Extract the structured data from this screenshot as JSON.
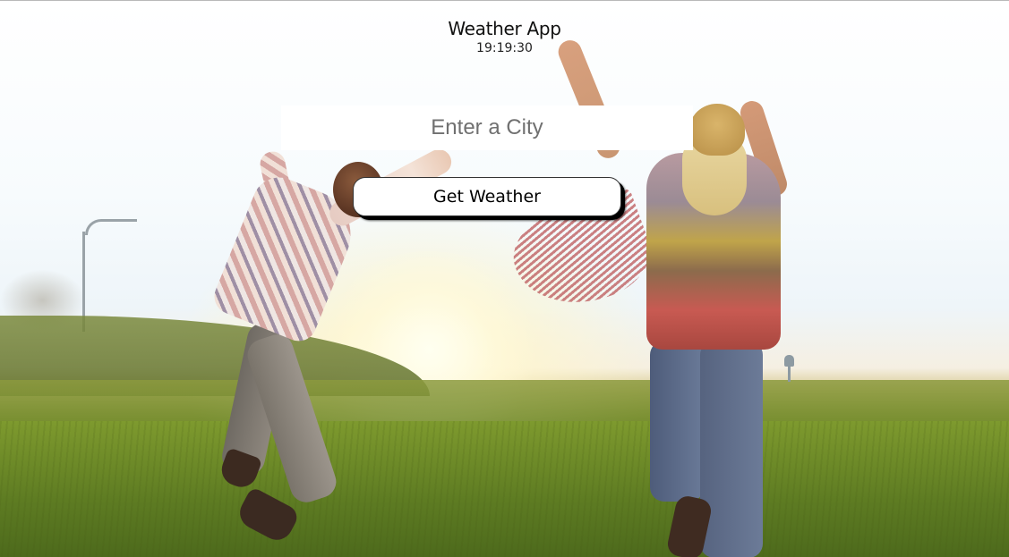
{
  "header": {
    "title": "Weather App",
    "clock": "19:19:30"
  },
  "search": {
    "placeholder": "Enter a City",
    "value": ""
  },
  "actions": {
    "get_weather_label": "Get Weather"
  },
  "colors": {
    "input_background": "#ffffff",
    "button_background": "#ffffff",
    "button_shadow": "#000000",
    "text": "#111111",
    "placeholder": "#707070"
  }
}
